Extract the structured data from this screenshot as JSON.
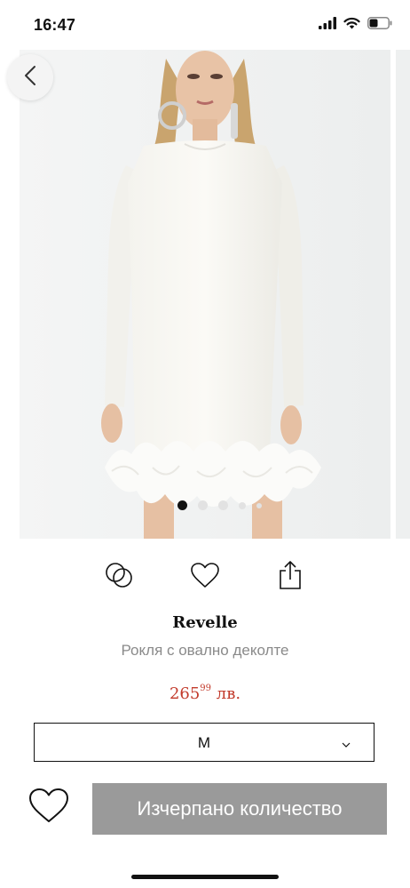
{
  "status_bar": {
    "time": "16:47",
    "battery_level": 0.45
  },
  "carousel": {
    "image_count": 5,
    "active_index": 0
  },
  "product": {
    "brand": "Revelle",
    "name": "Рокля с овално деколте",
    "price_main": "265",
    "price_cents": "99",
    "currency": "лв."
  },
  "size_selector": {
    "selected": "M"
  },
  "cta": {
    "label": "Изчерпано количество"
  },
  "icons": [
    "back-chevron-icon",
    "compare-icon",
    "heart-icon",
    "share-icon",
    "chevron-down-icon",
    "signal-icon",
    "wifi-icon",
    "battery-icon"
  ]
}
